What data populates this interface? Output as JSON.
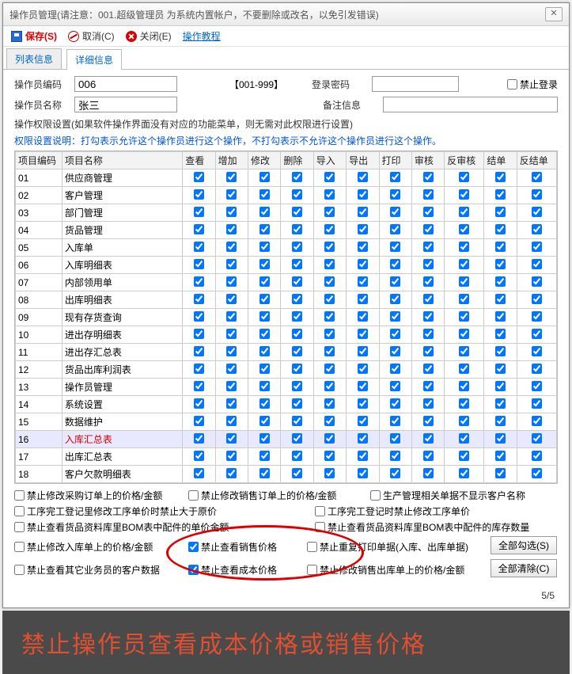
{
  "titlebar": {
    "title": "操作员管理(请注意：001.超级管理员 为系统内置帐户，不要删除或改名，以免引发错误)"
  },
  "toolbar": {
    "save": "保存(S)",
    "cancel": "取消(C)",
    "close": "关闭(E)",
    "tutorial": "操作教程"
  },
  "tabs": {
    "list": "列表信息",
    "detail": "详细信息"
  },
  "form": {
    "code_label": "操作员编码",
    "code_value": "006",
    "code_range": "【001-999】",
    "name_label": "操作员名称",
    "name_value": "张三",
    "pwd_label": "登录密码",
    "pwd_value": "",
    "memo_label": "备注信息",
    "memo_value": "",
    "forbid_label": "禁止登录",
    "perm_hint": "操作权限设置(如果软件操作界面没有对应的功能菜单，则无需对此权限进行设置)",
    "perm_hint2": "权限设置说明：打勾表示允许这个操作员进行这个操作，不打勾表示不允许这个操作员进行这个操作。"
  },
  "grid": {
    "cols": [
      "项目编码",
      "项目名称",
      "查看",
      "增加",
      "修改",
      "删除",
      "导入",
      "导出",
      "打印",
      "审核",
      "反审核",
      "结单",
      "反结单"
    ],
    "rows": [
      {
        "id": "01",
        "name": "供应商管理"
      },
      {
        "id": "02",
        "name": "客户管理"
      },
      {
        "id": "03",
        "name": "部门管理"
      },
      {
        "id": "04",
        "name": "货品管理"
      },
      {
        "id": "05",
        "name": "入库单"
      },
      {
        "id": "06",
        "name": "入库明细表"
      },
      {
        "id": "07",
        "name": "内部领用单"
      },
      {
        "id": "08",
        "name": "出库明细表"
      },
      {
        "id": "09",
        "name": "现有存货查询"
      },
      {
        "id": "10",
        "name": "进出存明细表"
      },
      {
        "id": "11",
        "name": "进出存汇总表"
      },
      {
        "id": "12",
        "name": "货品出库利润表"
      },
      {
        "id": "13",
        "name": "操作员管理"
      },
      {
        "id": "14",
        "name": "系统设置"
      },
      {
        "id": "15",
        "name": "数据维护"
      },
      {
        "id": "16",
        "name": "入库汇总表",
        "hl": true
      },
      {
        "id": "17",
        "name": "出库汇总表"
      },
      {
        "id": "18",
        "name": "客户欠款明细表"
      }
    ]
  },
  "opts": {
    "r1a": "禁止修改采购订单上的价格/金额",
    "r1b": "禁止修改销售订单上的价格/金额",
    "r1c": "生产管理相关单据不显示客户名称",
    "r2a": "工序完工登记里修改工序单价时禁止大于原价",
    "r2c": "工序完工登记时禁止修改工序单价",
    "r3a": "禁止查看货品资料库里BOM表中配件的单价金额",
    "r3c": "禁止查看货品资料库里BOM表中配件的库存数量",
    "r4a": "禁止修改入库单上的价格/金额",
    "r4b": "禁止查看销售价格",
    "r4c": "禁止重复打印单据(入库、出库单据)",
    "r5a": "禁止查看其它业务员的客户数据",
    "r5b": "禁止查看成本价格",
    "r5c": "禁止修改销售出库单上的价格/金额"
  },
  "buttons": {
    "all": "全部勾选(S)",
    "none": "全部清除(C)"
  },
  "pager": "5/5",
  "annotation": "禁止操作员查看成本价格或销售价格"
}
